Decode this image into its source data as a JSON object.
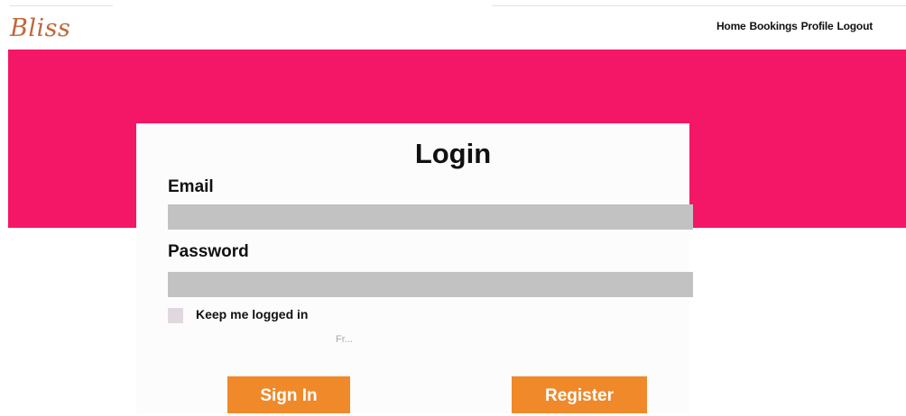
{
  "header": {
    "logo": "Bliss",
    "nav": [
      "Home",
      "Bookings",
      "Profile",
      "Logout"
    ]
  },
  "login": {
    "title": "Login",
    "email_label": "Email",
    "email_value": "",
    "password_label": "Password",
    "password_value": "",
    "keep_logged_in_label": "Keep me logged in",
    "small_text": "Fr...",
    "sign_in_label": "Sign In",
    "register_label": "Register"
  },
  "colors": {
    "hero": "#f41767",
    "button": "#f0892a",
    "logo": "#c0673a",
    "field": "#c2c2c2"
  }
}
